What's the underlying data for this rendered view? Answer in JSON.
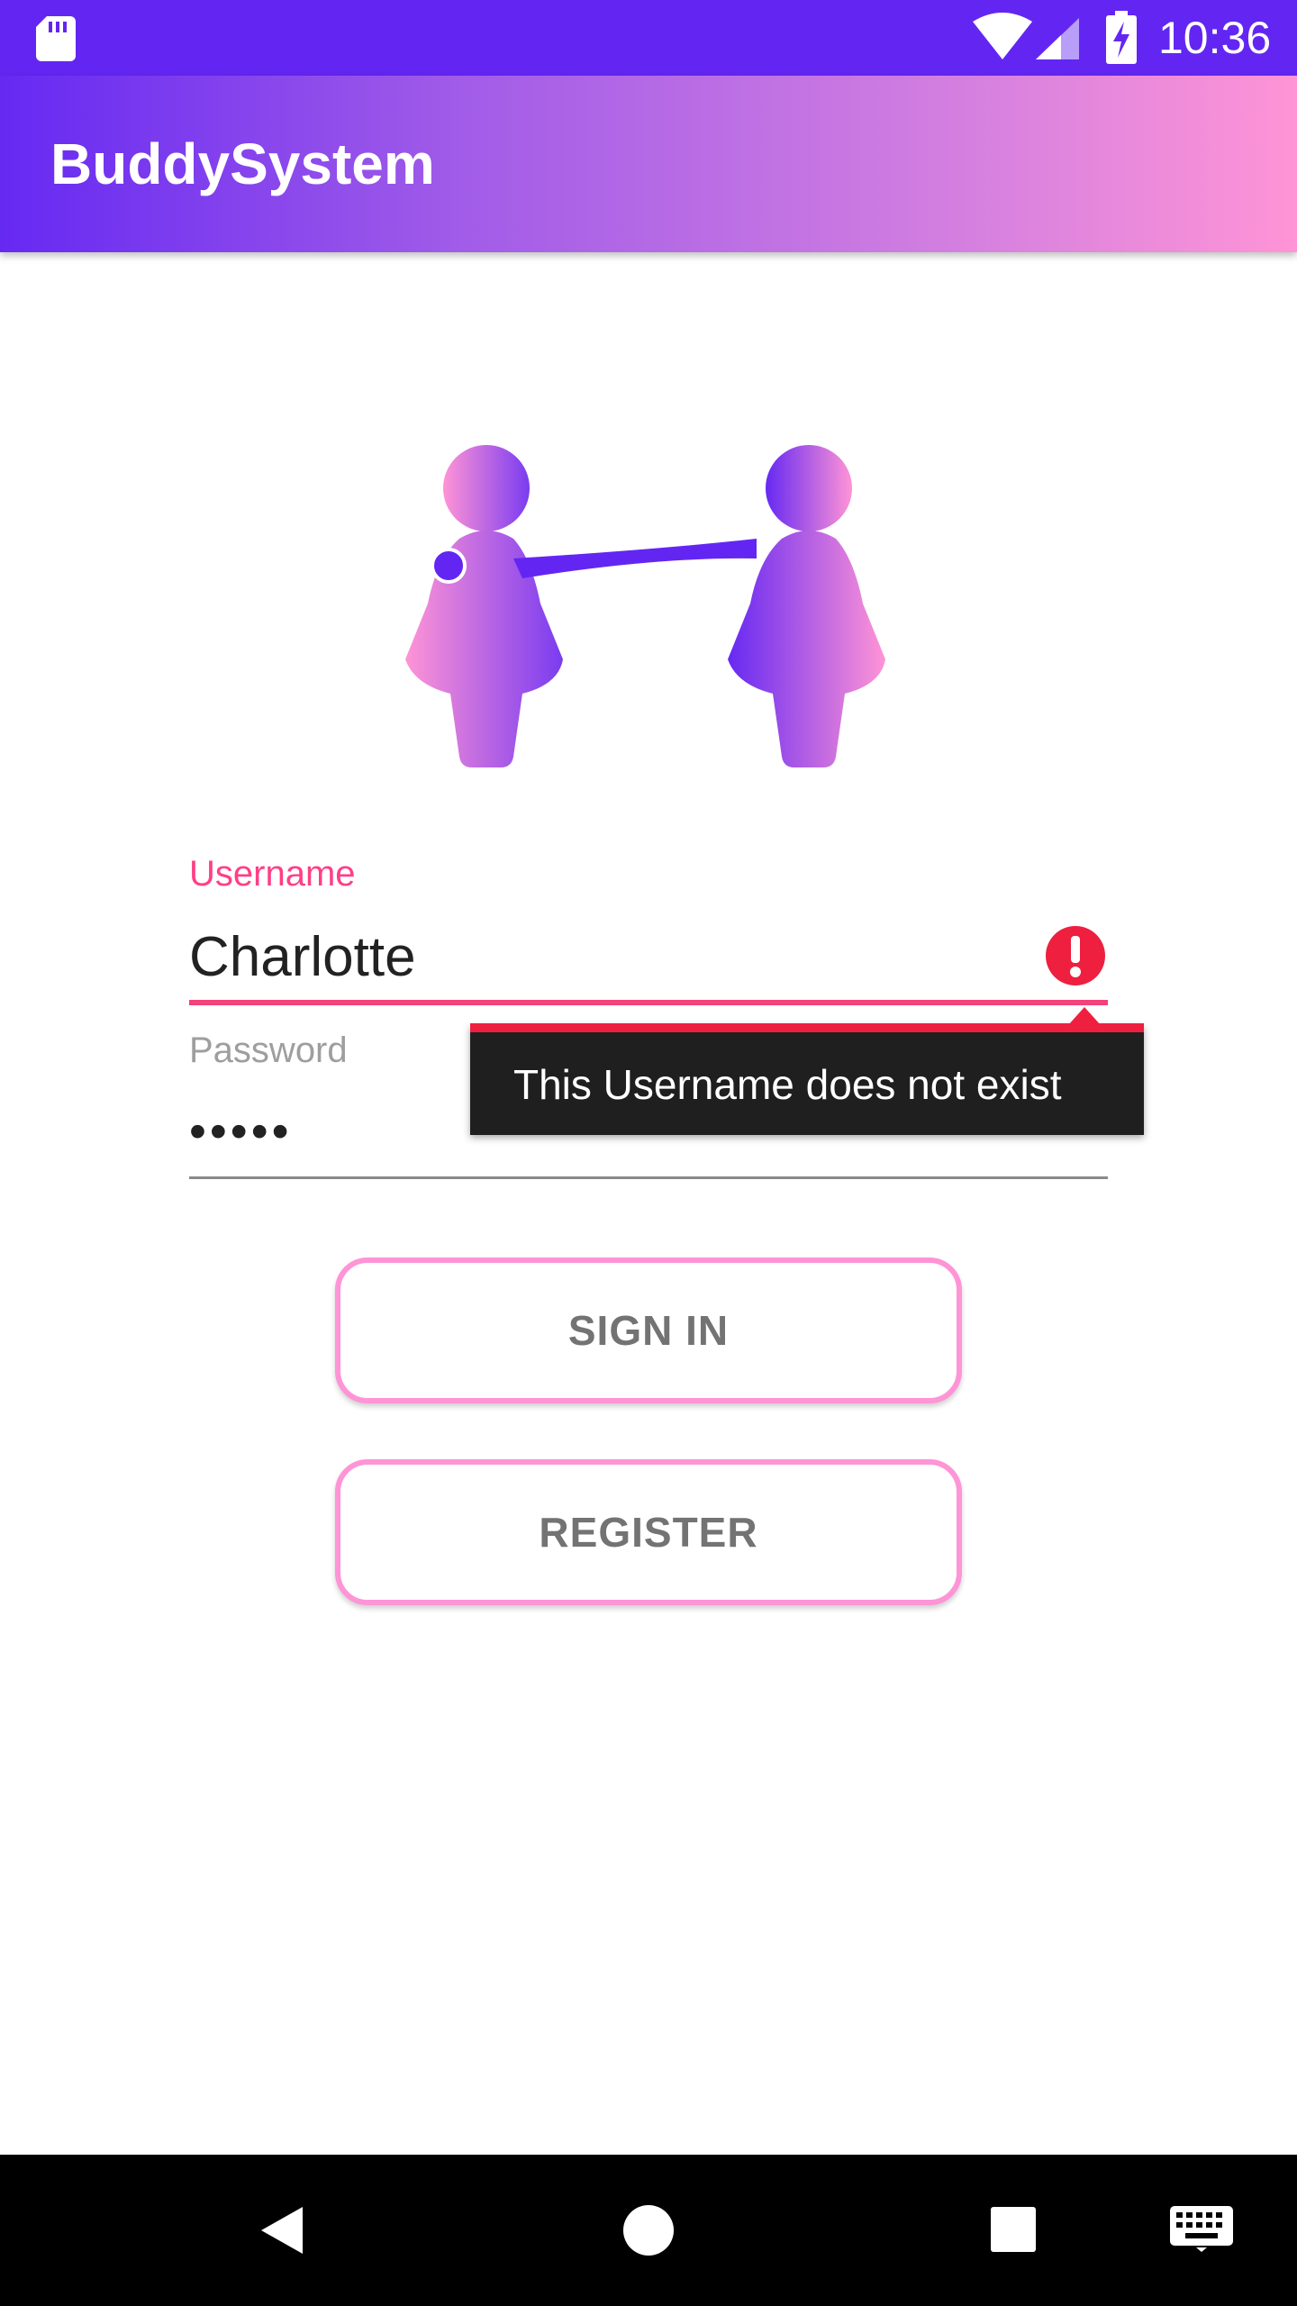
{
  "status_bar": {
    "time": "10:36",
    "icons": [
      "sd-card-icon",
      "wifi-icon",
      "cell-signal-icon",
      "battery-charging-icon"
    ]
  },
  "app_bar": {
    "title": "BuddySystem"
  },
  "logo": {
    "icon": "buddy-logo-icon"
  },
  "form": {
    "username_label": "Username",
    "username_value": "Charlotte",
    "password_label": "Password",
    "password_value": "•••••",
    "error_icon": "error-circle-icon",
    "error_message": "This Username does not exist"
  },
  "buttons": {
    "sign_in": "SIGN IN",
    "register": "REGISTER"
  },
  "nav_bar": {
    "icons": [
      "back-icon",
      "home-icon",
      "recents-icon",
      "keyboard-icon"
    ]
  },
  "colors": {
    "status_bar": "#6326f2",
    "gradient_start": "#6629f2",
    "gradient_end": "#ff94d6",
    "accent_pink": "#ff3f86",
    "error_red": "#ee1f3f",
    "button_border": "#ff94d6"
  }
}
